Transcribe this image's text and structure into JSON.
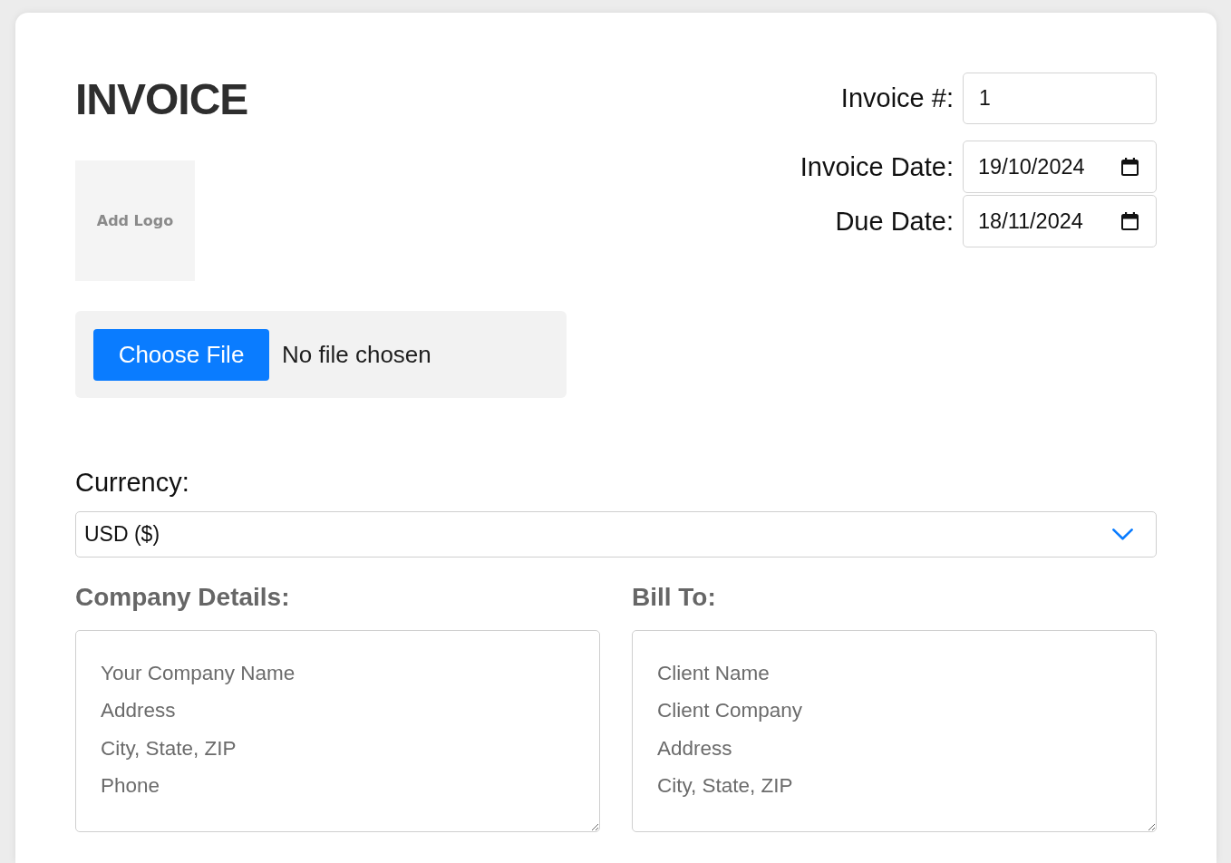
{
  "title": "INVOICE",
  "logo": {
    "label": "Add Logo"
  },
  "file_picker": {
    "button": "Choose File",
    "status": "No file chosen"
  },
  "meta_fields": [
    {
      "label": "Invoice #:",
      "value": "1",
      "kind": "text"
    },
    {
      "label": "Invoice Date:",
      "value": "19/10/2024",
      "kind": "date"
    },
    {
      "label": "Due Date:",
      "value": "18/11/2024",
      "kind": "date"
    }
  ],
  "currency": {
    "label": "Currency:",
    "value": "USD ($)"
  },
  "address_blocks": [
    {
      "heading": "Company Details:",
      "placeholder": "Your Company Name\nAddress\nCity, State, ZIP\nPhone"
    },
    {
      "heading": "Bill To:",
      "placeholder": "Client Name\nClient Company\nAddress\nCity, State, ZIP"
    }
  ]
}
